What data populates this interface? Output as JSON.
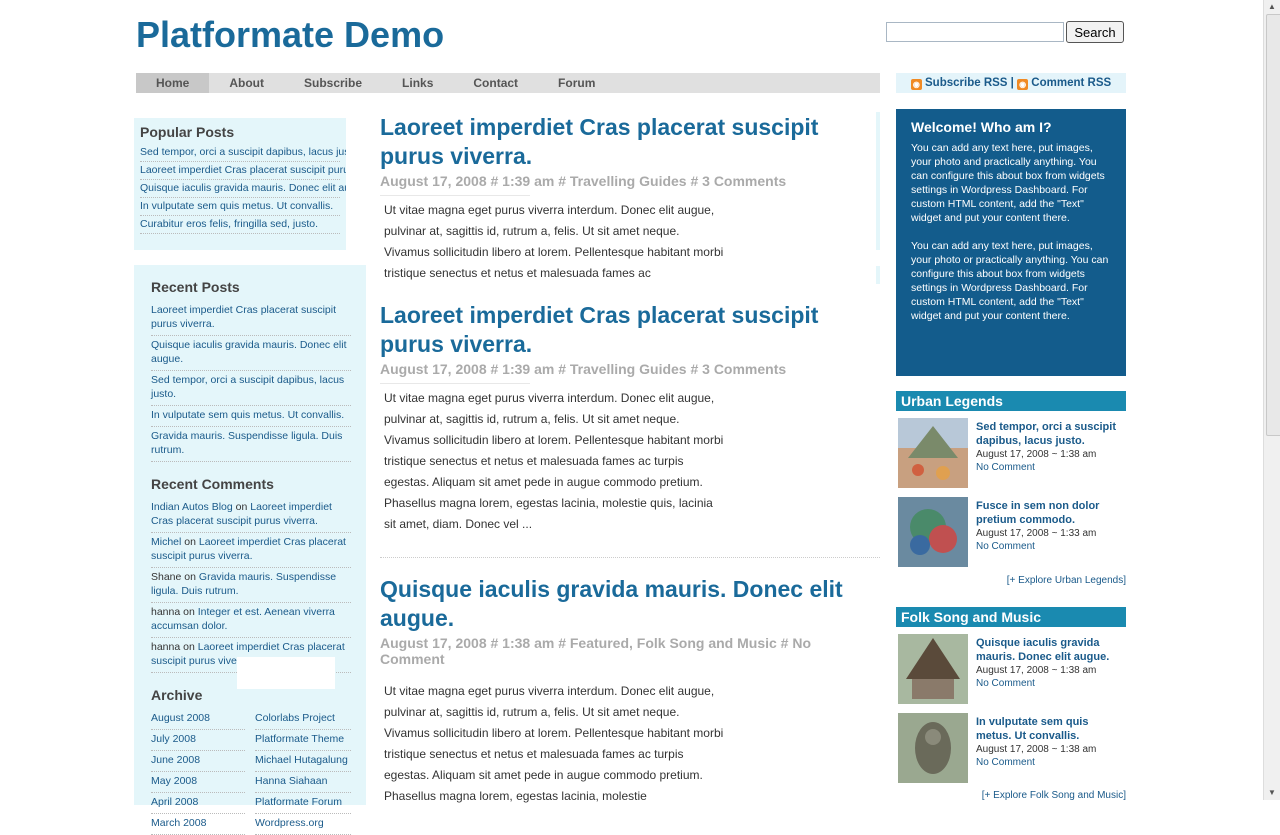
{
  "site": {
    "title": "Platformate Demo",
    "search_button": "Search",
    "search_value": ""
  },
  "nav": [
    "Home",
    "About",
    "Subscribe",
    "Links",
    "Contact",
    "Forum"
  ],
  "rss": {
    "subscribe": "Subscribe RSS",
    "separator": "|",
    "comment": "Comment RSS"
  },
  "popular": {
    "heading": "Popular Posts",
    "items": [
      "Sed tempor, orci a suscipit dapibus, lacus justo.",
      "Laoreet imperdiet Cras placerat suscipit purus viverra.",
      "Quisque iaculis gravida mauris. Donec elit augue.",
      "In vulputate sem quis metus. Ut convallis.",
      "Curabitur eros felis, fringilla sed, justo."
    ]
  },
  "recent_posts": {
    "heading": "Recent Posts",
    "items": [
      "Laoreet imperdiet Cras placerat suscipit purus viverra.",
      "Quisque iaculis gravida mauris. Donec elit augue.",
      "Sed tempor, orci a suscipit dapibus, lacus justo.",
      "In vulputate sem quis metus. Ut convallis.",
      "Gravida mauris. Suspendisse ligula. Duis rutrum."
    ]
  },
  "recent_comments": {
    "heading": "Recent Comments",
    "items": [
      {
        "author": "Indian Autos Blog",
        "on": "on",
        "post": "Laoreet imperdiet Cras placerat suscipit purus viverra."
      },
      {
        "author": "Michel",
        "on": "on",
        "post": "Laoreet imperdiet Cras placerat suscipit purus viverra."
      },
      {
        "author": "Shane",
        "on": "on",
        "post": "Gravida mauris. Suspendisse ligula. Duis rutrum."
      },
      {
        "author": "hanna",
        "on": "on",
        "post": "Integer et est. Aenean viverra accumsan dolor."
      },
      {
        "author": "hanna",
        "on": "on",
        "post": "Laoreet imperdiet Cras placerat suscipit purus viverra."
      }
    ]
  },
  "archive": {
    "heading": "Archive",
    "months": [
      "August 2008",
      "July 2008",
      "June 2008",
      "May 2008",
      "April 2008",
      "March 2008"
    ],
    "links": [
      "Colorlabs Project",
      "Platformate Theme",
      "Michael Hutagalung",
      "Hanna Siahaan",
      "Platformate Forum",
      "Wordpress.org"
    ]
  },
  "posts": [
    {
      "title": "Laoreet imperdiet Cras placerat suscipit purus viverra.",
      "meta": "August 17, 2008 # 1:39 am # Travelling Guides # 3 Comments",
      "body": "Ut vitae magna eget purus viverra interdum. Donec elit augue, pulvinar at, sagittis id, rutrum a, felis. Ut sit amet neque. Vivamus sollicitudin libero at lorem. Pellentesque habitant morbi tristique senectus et netus et malesuada fames ac"
    },
    {
      "title": "Laoreet imperdiet Cras placerat suscipit purus viverra.",
      "meta": "August 17, 2008 # 1:39 am # Travelling Guides # 3 Comments",
      "body": "Ut vitae magna eget purus viverra interdum. Donec elit augue, pulvinar at, sagittis id, rutrum a, felis. Ut sit amet neque. Vivamus sollicitudin libero at lorem. Pellentesque habitant morbi tristique senectus et netus et malesuada fames ac turpis egestas. Aliquam sit amet pede in augue commodo pretium. Phasellus magna lorem, egestas lacinia, molestie quis, lacinia sit amet, diam. Donec vel ..."
    },
    {
      "title": "Quisque iaculis gravida mauris. Donec elit augue.",
      "meta": "August 17, 2008 # 1:38 am # Featured, Folk Song and Music # No Comment",
      "body": "Ut vitae magna eget purus viverra interdum. Donec elit augue, pulvinar at, sagittis id, rutrum a, felis. Ut sit amet neque. Vivamus sollicitudin libero at lorem. Pellentesque habitant morbi tristique senectus et netus et malesuada fames ac turpis egestas. Aliquam sit amet pede in augue commodo pretium. Phasellus magna lorem, egestas lacinia, molestie"
    }
  ],
  "welcome": {
    "heading": "Welcome! Who am I?",
    "paragraphs": [
      "You can add any text here, put images, your photo and practically anything. You can configure this about box from widgets settings in Wordpress Dashboard. For custom HTML content, add the \"Text\" widget and put your content there.",
      "You can add any text here, put images, your photo or practically anything. You can configure this about box from widgets settings in Wordpress Dashboard. For custom HTML content, add the \"Text\" widget and put your content there."
    ]
  },
  "urban": {
    "heading": "Urban Legends",
    "items": [
      {
        "title": "Sed tempor, orci a suscipit dapibus, lacus justo.",
        "date": "August 17, 2008 ~ 1:38 am",
        "comment": "No Comment"
      },
      {
        "title": "Fusce in sem non dolor pretium commodo.",
        "date": "August 17, 2008 ~ 1:33 am",
        "comment": "No Comment"
      }
    ],
    "explore": "[+ Explore Urban Legends]"
  },
  "folk": {
    "heading": "Folk Song and Music",
    "items": [
      {
        "title": "Quisque iaculis gravida mauris. Donec elit augue.",
        "date": "August 17, 2008 ~ 1:38 am",
        "comment": "No Comment"
      },
      {
        "title": "In vulputate sem quis metus. Ut convallis.",
        "date": "August 17, 2008 ~ 1:38 am",
        "comment": "No Comment"
      }
    ],
    "explore": "[+ Explore Folk Song and Music]"
  },
  "colors": {
    "title_blue": "#1a6a9a",
    "link_blue": "#1a5a8a",
    "welcome_bg": "#135c8c",
    "widget_header": "#1a8ab0",
    "sidebar_bg": "#e4f6fa",
    "rss_orange": "#f08a24"
  }
}
